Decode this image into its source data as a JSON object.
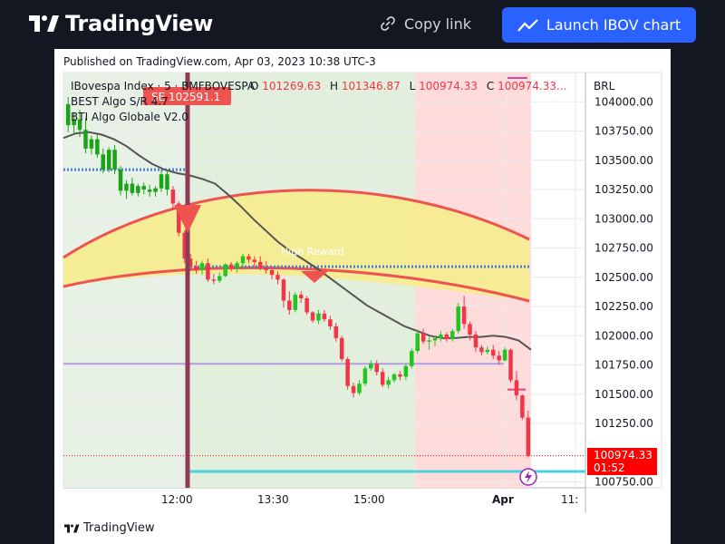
{
  "header": {
    "brand": "TradingView",
    "copy_link_label": "Copy link",
    "launch_label": "Launch IBOV chart",
    "accent": "#2962ff"
  },
  "published": "Published on TradingView.com, Apr 03, 2023 10:38 UTC-3",
  "footer_brand": "TradingView",
  "legend": {
    "symbol": "IBovespa Index · 5 · BMFBOVESPA",
    "o_label": "O",
    "o_value": "101269.63",
    "h_label": "H",
    "h_value": "101346.87",
    "l_label": "L",
    "l_value": "100974.33",
    "c_label": "C",
    "c_value": "100974.33...",
    "indicator1": "BEST Algo S/R 4.7",
    "indicator2": "BTI Algo Globale V2.0"
  },
  "sell_label": "SE 102591.1",
  "high_reward_label": "High Reward",
  "chart_data": {
    "type": "candlestick",
    "currency": "BRL",
    "y_ticks": [
      "104000.00",
      "103750.00",
      "103500.00",
      "103250.00",
      "103000.00",
      "102750.00",
      "102500.00",
      "102250.00",
      "102000.00",
      "101750.00",
      "101500.00",
      "101250.00",
      "100750.00"
    ],
    "y_tick_values": [
      104000,
      103750,
      103500,
      103250,
      103000,
      102750,
      102500,
      102250,
      102000,
      101750,
      101500,
      101250,
      100750
    ],
    "ylim": [
      100700,
      104250
    ],
    "x_ticks": [
      "12:00",
      "13:30",
      "15:00",
      "Apr",
      "11:"
    ],
    "last_price": "100974.33",
    "countdown": "01:52",
    "colors": {
      "up": "#22c51e",
      "down": "#f23645",
      "last_price": "#ff0000"
    },
    "candles": [
      [
        103980,
        104040,
        103740,
        103800
      ],
      [
        103800,
        103910,
        103720,
        103850
      ],
      [
        103850,
        103930,
        103700,
        103760
      ],
      [
        103760,
        103860,
        103560,
        103600
      ],
      [
        103600,
        103710,
        103550,
        103680
      ],
      [
        103680,
        103720,
        103520,
        103550
      ],
      [
        103550,
        103600,
        103390,
        103420
      ],
      [
        103420,
        103610,
        103400,
        103590
      ],
      [
        103590,
        103630,
        103380,
        103420
      ],
      [
        103420,
        103450,
        103200,
        103240
      ],
      [
        103240,
        103330,
        103170,
        103300
      ],
      [
        103300,
        103350,
        103200,
        103220
      ],
      [
        103220,
        103300,
        103190,
        103280
      ],
      [
        103280,
        103310,
        103210,
        103250
      ],
      [
        103250,
        103290,
        103190,
        103230
      ],
      [
        103230,
        103280,
        103190,
        103260
      ],
      [
        103260,
        103420,
        103230,
        103380
      ],
      [
        103380,
        103420,
        103200,
        103250
      ],
      [
        103250,
        103280,
        103080,
        103130
      ],
      [
        103130,
        103150,
        102850,
        102880
      ],
      [
        102880,
        102900,
        102620,
        102660
      ],
      [
        102660,
        102700,
        102560,
        102590
      ],
      [
        102590,
        102640,
        102530,
        102560
      ],
      [
        102560,
        102640,
        102520,
        102620
      ],
      [
        102620,
        102660,
        102460,
        102480
      ],
      [
        102480,
        102530,
        102440,
        102470
      ],
      [
        102470,
        102540,
        102450,
        102510
      ],
      [
        102510,
        102620,
        102500,
        102610
      ],
      [
        102610,
        102630,
        102550,
        102580
      ],
      [
        102580,
        102640,
        102540,
        102620
      ],
      [
        102620,
        102700,
        102580,
        102680
      ],
      [
        102680,
        102700,
        102620,
        102650
      ],
      [
        102650,
        102680,
        102590,
        102630
      ],
      [
        102630,
        102680,
        102560,
        102580
      ],
      [
        102580,
        102640,
        102530,
        102560
      ],
      [
        102560,
        102590,
        102480,
        102520
      ],
      [
        102520,
        102550,
        102440,
        102480
      ],
      [
        102480,
        102490,
        102240,
        102300
      ],
      [
        102300,
        102380,
        102180,
        102220
      ],
      [
        102220,
        102370,
        102200,
        102350
      ],
      [
        102350,
        102380,
        102280,
        102320
      ],
      [
        102320,
        102340,
        102180,
        102200
      ],
      [
        102200,
        102210,
        102110,
        102130
      ],
      [
        102130,
        102220,
        102100,
        102190
      ],
      [
        102190,
        102220,
        102120,
        102140
      ],
      [
        102140,
        102170,
        102050,
        102080
      ],
      [
        102080,
        102110,
        101950,
        101980
      ],
      [
        101980,
        102000,
        101780,
        101800
      ],
      [
        101800,
        101820,
        101540,
        101570
      ],
      [
        101570,
        101600,
        101470,
        101510
      ],
      [
        101510,
        101620,
        101490,
        101590
      ],
      [
        101590,
        101740,
        101570,
        101720
      ],
      [
        101720,
        101790,
        101700,
        101760
      ],
      [
        101760,
        101790,
        101660,
        101690
      ],
      [
        101690,
        101720,
        101560,
        101580
      ],
      [
        101580,
        101650,
        101550,
        101620
      ],
      [
        101620,
        101680,
        101600,
        101670
      ],
      [
        101670,
        101700,
        101620,
        101650
      ],
      [
        101650,
        101760,
        101620,
        101740
      ],
      [
        101740,
        101890,
        101720,
        101870
      ],
      [
        101870,
        102050,
        101850,
        102020
      ],
      [
        102020,
        102060,
        101930,
        101950
      ],
      [
        101950,
        101990,
        101880,
        101960
      ],
      [
        101960,
        102000,
        101910,
        101980
      ],
      [
        101980,
        102040,
        101950,
        102010
      ],
      [
        102010,
        102030,
        101950,
        101970
      ],
      [
        101970,
        102060,
        101950,
        102040
      ],
      [
        102040,
        102280,
        102020,
        102250
      ],
      [
        102250,
        102340,
        102060,
        102100
      ],
      [
        102100,
        102120,
        101960,
        102010
      ],
      [
        102010,
        102040,
        101860,
        101900
      ],
      [
        101900,
        101920,
        101830,
        101860
      ],
      [
        101860,
        101910,
        101840,
        101880
      ],
      [
        101880,
        101920,
        101800,
        101830
      ],
      [
        101830,
        101870,
        101750,
        101790
      ],
      [
        101790,
        101900,
        101780,
        101880
      ],
      [
        101880,
        101890,
        101600,
        101620
      ],
      [
        101620,
        101700,
        101450,
        101490
      ],
      [
        101490,
        101500,
        101280,
        101300
      ],
      [
        101300,
        101360,
        100960,
        100974.33
      ]
    ],
    "ma_values": [
      103690,
      103730,
      103740,
      103720,
      103680,
      103620,
      103540,
      103470,
      103420,
      103390,
      103370,
      103340,
      103300,
      103210,
      103110,
      103000,
      102900,
      102800,
      102720,
      102650,
      102580,
      102500,
      102420,
      102340,
      102260,
      102200,
      102140,
      102080,
      102040,
      102000,
      101980,
      101980,
      101990,
      101990,
      102000,
      101990,
      101960,
      101880
    ],
    "ma_color": "#555555",
    "blue_dotted_levels": [
      103420,
      102590
    ],
    "purple_level": 101760,
    "cyan_level": 100840,
    "sell_signal_price": 102591.1
  }
}
